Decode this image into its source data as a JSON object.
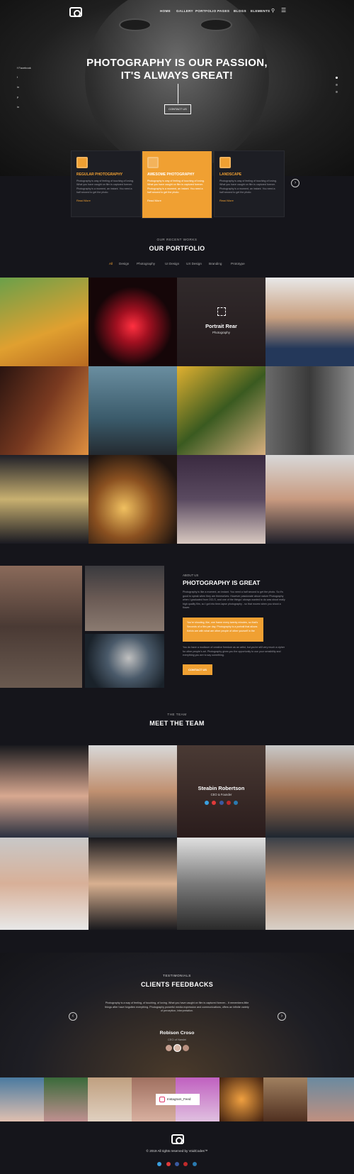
{
  "nav": {
    "items": [
      "HOME",
      "GALLERY",
      "PORTFOLIO",
      "PAGES",
      "BLOGS",
      "ELEMENTS"
    ]
  },
  "hero": {
    "title_line1": "PHOTOGRAPHY IS OUR PASSION,",
    "title_line2": "IT'S ALWAYS GREAT!",
    "button": "CONTACT US",
    "social": [
      "f Facebook",
      "t",
      "in",
      "p",
      "in"
    ]
  },
  "features": [
    {
      "title": "REGULAR PHOTOGRAPHY",
      "desc": "Photography is way of feeling of touching of loving. What you have caught on film is captured forever. Photography is a moment, an instant. You need a half second to get the photo.",
      "link": "Read More"
    },
    {
      "title": "AWESOME PHOTOGRAPHY",
      "desc": "Photography is way of feeling of touching of loving. What you have caught on film is captured forever. Photography is a moment, an instant. You need a half second to get the photo.",
      "link": "Read More"
    },
    {
      "title": "LANDSCAPE",
      "desc": "Photography is way of feeling of touching of loving. What you have caught on film is captured forever. Photography is a moment, an instant. You need a half second to get the photo.",
      "link": "Read More"
    }
  ],
  "portfolio": {
    "kicker": "OUR RECENT WORKS",
    "title": "OUR PORTFOLIO",
    "filters": [
      "All",
      "Design",
      "Photography",
      "UI Design",
      "UX Design",
      "Branding",
      "Prototype"
    ],
    "hover_title": "Portrait Rear",
    "hover_sub": "Photography"
  },
  "about": {
    "kicker": "ABOUT US",
    "title": "PHOTOGRAPHY IS GREAT",
    "para1": "Photography is like a moment, an instant. You need a half second to get the photo. So it's good to speak when they are themselves. However passionate about nature Photography when I graduated from OCLS, and one of the things I always wanted to do was shoot really high quality film, so I got into time-lapse photography - so that moves when you shoot a flower.",
    "checks": [
      "You're shooting, like, one frame every twenty minutes, so that's",
      "Seconds of a film per day. Photography is a portrait that allows",
      "Kelvin are with what are other people of other yourself in the"
    ],
    "para2": "You do have a modicum of creative freedom as an artist, but you're still very much a cipher for other people's art. Photography gives you the opportunity to use your sensibility and everything you are to say something.",
    "button": "CONTACT US"
  },
  "team": {
    "kicker": "THE TEAM",
    "title": "MEET THE TEAM",
    "hover_name": "Steabin Robertson",
    "hover_role": "CEO & Founder"
  },
  "testimonials": {
    "kicker": "TESTIMONIALS",
    "title": "CLIENTS FEEDBACKS",
    "quote": "Photography is a way of feeling, of touching, of loving. What you have caught on film is captured forever... It remembers little things after have forgotten everything. Photography powerful media expression and communications, offers an infinite variety of perception, interpretation.",
    "name": "Robison Croso",
    "role": "CEO of Nawlei"
  },
  "instagram": {
    "label": "Instagram_Feed"
  },
  "footer": {
    "copyright": "© 2019 All rights reserved by VoidCodes™"
  },
  "colors": {
    "accent": "#f0a032",
    "bg": "#15151b"
  }
}
